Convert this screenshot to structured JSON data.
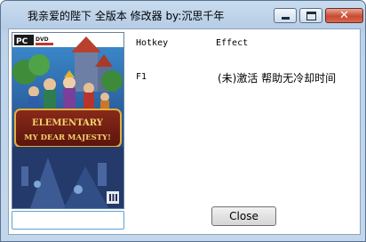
{
  "window": {
    "title": "我亲爱的陛下 全版本 修改器 by:沉思千年"
  },
  "controls": {
    "close_glyph": "✕"
  },
  "cover": {
    "platform_label": "PC",
    "dvd_label": "DVD",
    "logo_line1": "ELEMENTARY",
    "logo_line2": "MY DEAR MAJESTY!"
  },
  "table": {
    "hotkey_header": "Hotkey",
    "effect_header": "Effect",
    "rows": [
      {
        "hotkey": "F1",
        "effect": "(未)激活 帮助无冷却时间"
      }
    ]
  },
  "input": {
    "value": ""
  },
  "buttons": {
    "close_label": "Close"
  }
}
